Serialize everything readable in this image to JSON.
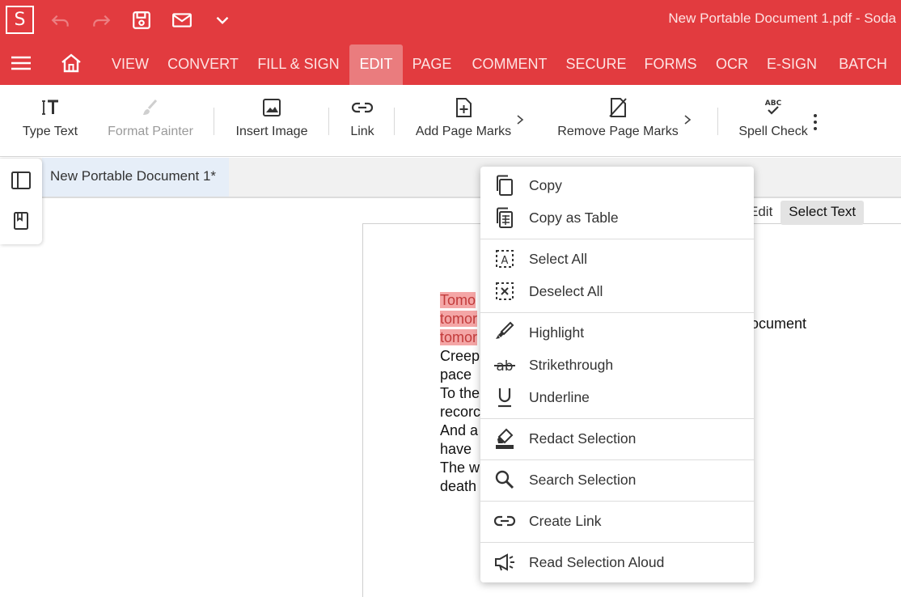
{
  "app": {
    "logo_letter": "S",
    "title": "New Portable Document 1.pdf   -   Soda",
    "accent_color": "#e23b3f",
    "active_tab_color": "#ea7c7e"
  },
  "quick_access": [
    {
      "name": "undo",
      "icon": "undo-icon",
      "enabled": false
    },
    {
      "name": "redo",
      "icon": "redo-icon",
      "enabled": false
    },
    {
      "name": "save",
      "icon": "save-icon",
      "enabled": true
    },
    {
      "name": "email",
      "icon": "mail-icon",
      "enabled": true
    },
    {
      "name": "more",
      "icon": "chevron-down-icon",
      "enabled": true
    }
  ],
  "menu": {
    "tabs": [
      {
        "label": "VIEW"
      },
      {
        "label": "CONVERT"
      },
      {
        "label": "FILL & SIGN"
      },
      {
        "label": "EDIT",
        "active": true
      },
      {
        "label": "PAGE"
      },
      {
        "label": "COMMENT"
      },
      {
        "label": "SECURE"
      },
      {
        "label": "FORMS"
      },
      {
        "label": "OCR"
      },
      {
        "label": "E-SIGN"
      },
      {
        "label": "BATCH"
      }
    ]
  },
  "ribbon": {
    "buttons": [
      {
        "label": "Type Text",
        "icon": "type-text-icon",
        "enabled": true
      },
      {
        "label": "Format Painter",
        "icon": "paint-brush-icon",
        "enabled": false
      },
      {
        "label": "Insert Image",
        "icon": "image-icon",
        "enabled": true
      },
      {
        "label": "Link",
        "icon": "link-icon",
        "enabled": true
      },
      {
        "label": "Add Page Marks",
        "icon": "add-page-icon",
        "enabled": true,
        "has_submenu": true
      },
      {
        "label": "Remove Page Marks",
        "icon": "remove-page-icon",
        "enabled": true,
        "has_submenu": true
      },
      {
        "label": "Spell Check",
        "icon": "spell-check-icon",
        "enabled": true
      }
    ]
  },
  "document_tab": {
    "label": "New Portable Document 1*"
  },
  "mode_toggle": {
    "edit_label": "Edit",
    "select_label": "Select Text",
    "selected": "Select Text"
  },
  "document": {
    "lines": [
      {
        "text": "Tomo",
        "highlighted": true
      },
      {
        "text": "tomor",
        "highlighted": true
      },
      {
        "text": "tomor",
        "highlighted": true
      },
      {
        "text": "Creep",
        "highlighted": false
      },
      {
        "text": "pace",
        "highlighted": false
      },
      {
        "text": "To the",
        "highlighted": false
      },
      {
        "text": "recorc",
        "highlighted": false
      },
      {
        "text": "And a",
        "highlighted": false
      },
      {
        "text": "have",
        "highlighted": false
      },
      {
        "text": "The w",
        "highlighted": false
      },
      {
        "text": "death",
        "highlighted": false
      }
    ],
    "right_fragment": "ocument"
  },
  "context_menu": {
    "groups": [
      [
        {
          "label": "Copy",
          "icon": "copy-icon"
        },
        {
          "label": "Copy as Table",
          "icon": "copy-table-icon"
        }
      ],
      [
        {
          "label": "Select All",
          "icon": "select-all-icon"
        },
        {
          "label": "Deselect All",
          "icon": "deselect-all-icon"
        }
      ],
      [
        {
          "label": "Highlight",
          "icon": "highlighter-icon"
        },
        {
          "label": "Strikethrough",
          "icon": "strikethrough-icon"
        },
        {
          "label": "Underline",
          "icon": "underline-icon"
        }
      ],
      [
        {
          "label": "Redact Selection",
          "icon": "redact-icon"
        }
      ],
      [
        {
          "label": "Search Selection",
          "icon": "search-icon"
        }
      ],
      [
        {
          "label": "Create Link",
          "icon": "link-icon"
        }
      ],
      [
        {
          "label": "Read Selection Aloud",
          "icon": "megaphone-icon"
        }
      ]
    ]
  }
}
